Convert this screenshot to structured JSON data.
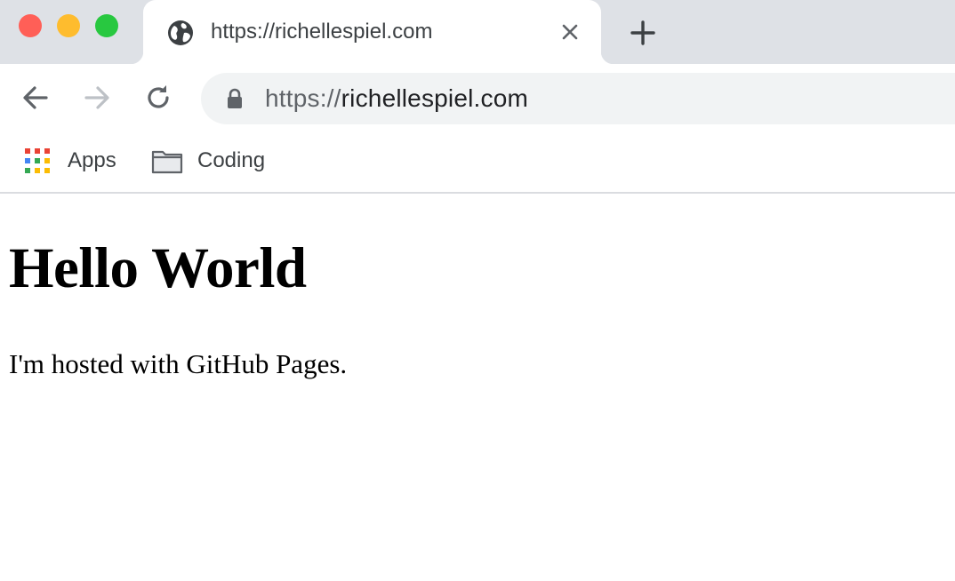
{
  "window": {
    "traffic_lights": {
      "close": "#ff5f57",
      "minimize": "#febc2e",
      "zoom": "#28c840"
    }
  },
  "tab": {
    "title": "https://richellespiel.com",
    "icon": "globe-icon",
    "close_icon": "close-icon"
  },
  "new_tab_icon": "plus-icon",
  "toolbar": {
    "back_icon": "arrow-left-icon",
    "forward_icon": "arrow-right-icon",
    "reload_icon": "reload-icon",
    "lock_icon": "lock-icon",
    "url_scheme": "https://",
    "url_host": "richellespiel.com"
  },
  "bookmarks": [
    {
      "label": "Apps",
      "icon": "apps-grid-icon"
    },
    {
      "label": "Coding",
      "icon": "folder-icon"
    }
  ],
  "page": {
    "heading": "Hello World",
    "paragraph": "I'm hosted with GitHub Pages."
  },
  "colors": {
    "tab_strip": "#dee1e6",
    "omnibox": "#f1f3f4",
    "apps_grid": [
      "#ea4335",
      "#fbbc04",
      "#34a853",
      "#4285f4"
    ]
  }
}
